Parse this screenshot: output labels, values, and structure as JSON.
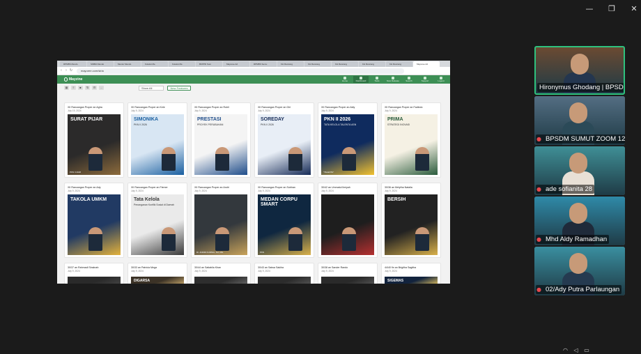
{
  "window": {
    "minimize_icon": "minimize-icon",
    "restore_icon": "restore-icon",
    "close_icon": "close-icon"
  },
  "browser": {
    "tabs": [
      "RPMBS Mendo",
      "SIMBA Mendo",
      "Mentor Mendo",
      "Koleksi Me",
      "Koleksi Me",
      "BKPPD Sum",
      "Mayuree Ad",
      "RPMBS Semu",
      "KH Rancang",
      "KH Rancang",
      "KH Rancang",
      "KH Rancang",
      "KH Rancang",
      "Mayuree Ad"
    ],
    "active_tab": 13,
    "url": "mayuree.com/siria"
  },
  "site": {
    "brand": "Mayzine",
    "nav": [
      "Home",
      "Dashboard",
      "Tools",
      "New Release",
      "Search",
      "Support",
      "Logout"
    ],
    "active_nav": 1,
    "filter_value": "Show All",
    "new_feature_label": "New Features",
    "accent": "#3d8f55"
  },
  "cards": [
    {
      "title": "XII Rancangan Proper an Agha",
      "date": "July 19, 2024",
      "head": "SURAT PIJAR",
      "sub": "",
      "foot": "PKN II 2026",
      "bg": "#2b2a2a",
      "accent": "#8d6b3c"
    },
    {
      "title": "XII Rancangan Proper an Kele",
      "date": "July 9, 2024",
      "head": "SIMONIKA",
      "sub": "PKN II 2026",
      "foot": "",
      "bg": "#d8e6f3",
      "accent": "#1a5fa0"
    },
    {
      "title": "XII Rancangan Proper an Rubil",
      "date": "July 9, 2024",
      "head": "PRESTASI",
      "sub": "PROYEK PERUBAHAN",
      "foot": "",
      "bg": "#f4f4f4",
      "accent": "#1f4d8a"
    },
    {
      "title": "XII Rancangan Proper an Giri",
      "date": "July 9, 2024",
      "head": "SOREDAY",
      "sub": "PKN II 2026",
      "foot": "",
      "bg": "#e8eef6",
      "accent": "#152a56"
    },
    {
      "title": "XII Rancangan Proper an Aldy",
      "date": "July 9, 2024",
      "head": "PKN II 2026",
      "sub": "TATA KELOLA TALENTA ASN",
      "foot": "\"TALENTA\"",
      "bg": "#0f2b5e",
      "accent": "#f2c230"
    },
    {
      "title": "XII Rancangan Proper an Fadindo",
      "date": "July 9, 2024",
      "head": "PRIMA",
      "sub": "STRATEGI INOVASI",
      "foot": "",
      "bg": "#f5f1e4",
      "accent": "#2a5b3c"
    },
    {
      "title": "XII Rancangan Proper an Ady",
      "date": "July 9, 2024",
      "head": "TAKOLA UMKM",
      "sub": "",
      "foot": "",
      "bg": "#213a63",
      "accent": "#e3b23c"
    },
    {
      "title": "XII Rancangan Proper an Fiemer",
      "date": "July 9, 2024",
      "head": "Tata Kelola",
      "sub": "Penanganan Konflik Sosial di Daerah",
      "foot": "",
      "bg": "#eaeaea",
      "accent": "#3a3a3a"
    },
    {
      "title": "XII Rancangan Proper an Andri",
      "date": "July 9, 2024",
      "head": "",
      "sub": "",
      "foot": "Dr. ANDRI KURNIA, SH, MH.",
      "bg": "#33383d",
      "accent": "#c9a35a"
    },
    {
      "title": "XII Rancangan Proper an Subhan",
      "date": "July 9, 2024",
      "head": "MEDAN CORPU SMART",
      "sub": "",
      "foot": "PKN",
      "bg": "#0f2740",
      "accent": "#d9b14a"
    },
    {
      "title": "30/42 an Ummatul Ilmiyah",
      "date": "July 9, 2024",
      "head": "",
      "sub": "",
      "foot": "",
      "bg": "#1e1e1e",
      "accent": "#b53030"
    },
    {
      "title": "30/36 an Melytha Natalia",
      "date": "July 9, 2024",
      "head": "BERSIH",
      "sub": "",
      "foot": "",
      "bg": "#222222",
      "accent": "#d8b04a"
    },
    {
      "title": "30/37 an Rahmadi Siraknah",
      "date": "July 9, 2024",
      "head": "",
      "sub": "",
      "foot": "",
      "bg": "#2a2a2a",
      "accent": "#444"
    },
    {
      "title": "30/33 an Patricia Mega",
      "date": "July 9, 2024",
      "head": "DIGARSA",
      "sub": "",
      "foot": "",
      "bg": "#3b3226",
      "accent": "#c7a76b"
    },
    {
      "title": "30/44 an Satiabila Khan",
      "date": "July 9, 2024",
      "head": "",
      "sub": "",
      "foot": "",
      "bg": "#2e2e2e",
      "accent": "#666"
    },
    {
      "title": "30/43 an Satwa Sakiha",
      "date": "July 9, 2024",
      "head": "",
      "sub": "",
      "foot": "",
      "bg": "#2c2c2c",
      "accent": "#555"
    },
    {
      "title": "30/38 an Sander Rando",
      "date": "July 9, 2024",
      "head": "",
      "sub": "",
      "foot": "",
      "bg": "#2a2a2a",
      "accent": "#555"
    },
    {
      "title": "44/40 fin an Brigitha Sagitha",
      "date": "July 9, 2024",
      "head": "SIGEMAS",
      "sub": "",
      "foot": "",
      "bg": "#12233d",
      "accent": "#e0c060"
    }
  ],
  "participants": [
    {
      "name": "Hironymus Ghodang | BPSD...",
      "muted": false,
      "speaking": true,
      "bg": "#6b4a32",
      "shirt": "#24364f"
    },
    {
      "name": "BPSDM SUMUT ZOOM 12",
      "muted": true,
      "speaking": false,
      "bg": "#546e83",
      "shirt": "#2b4a58"
    },
    {
      "name": "ade sofianita 28",
      "muted": true,
      "speaking": false,
      "bg": "#3f8f96",
      "shirt": "#e8e0d6"
    },
    {
      "name": "Mhd Aldy Ramadhan",
      "muted": true,
      "speaking": false,
      "bg": "#2f8aa8",
      "shirt": "#1f2a3a"
    },
    {
      "name": "02/Ady Putra Parlaungan",
      "muted": true,
      "speaking": false,
      "bg": "#3a8fa0",
      "shirt": "#253a50"
    }
  ],
  "muted_icon": "mic-off-icon"
}
